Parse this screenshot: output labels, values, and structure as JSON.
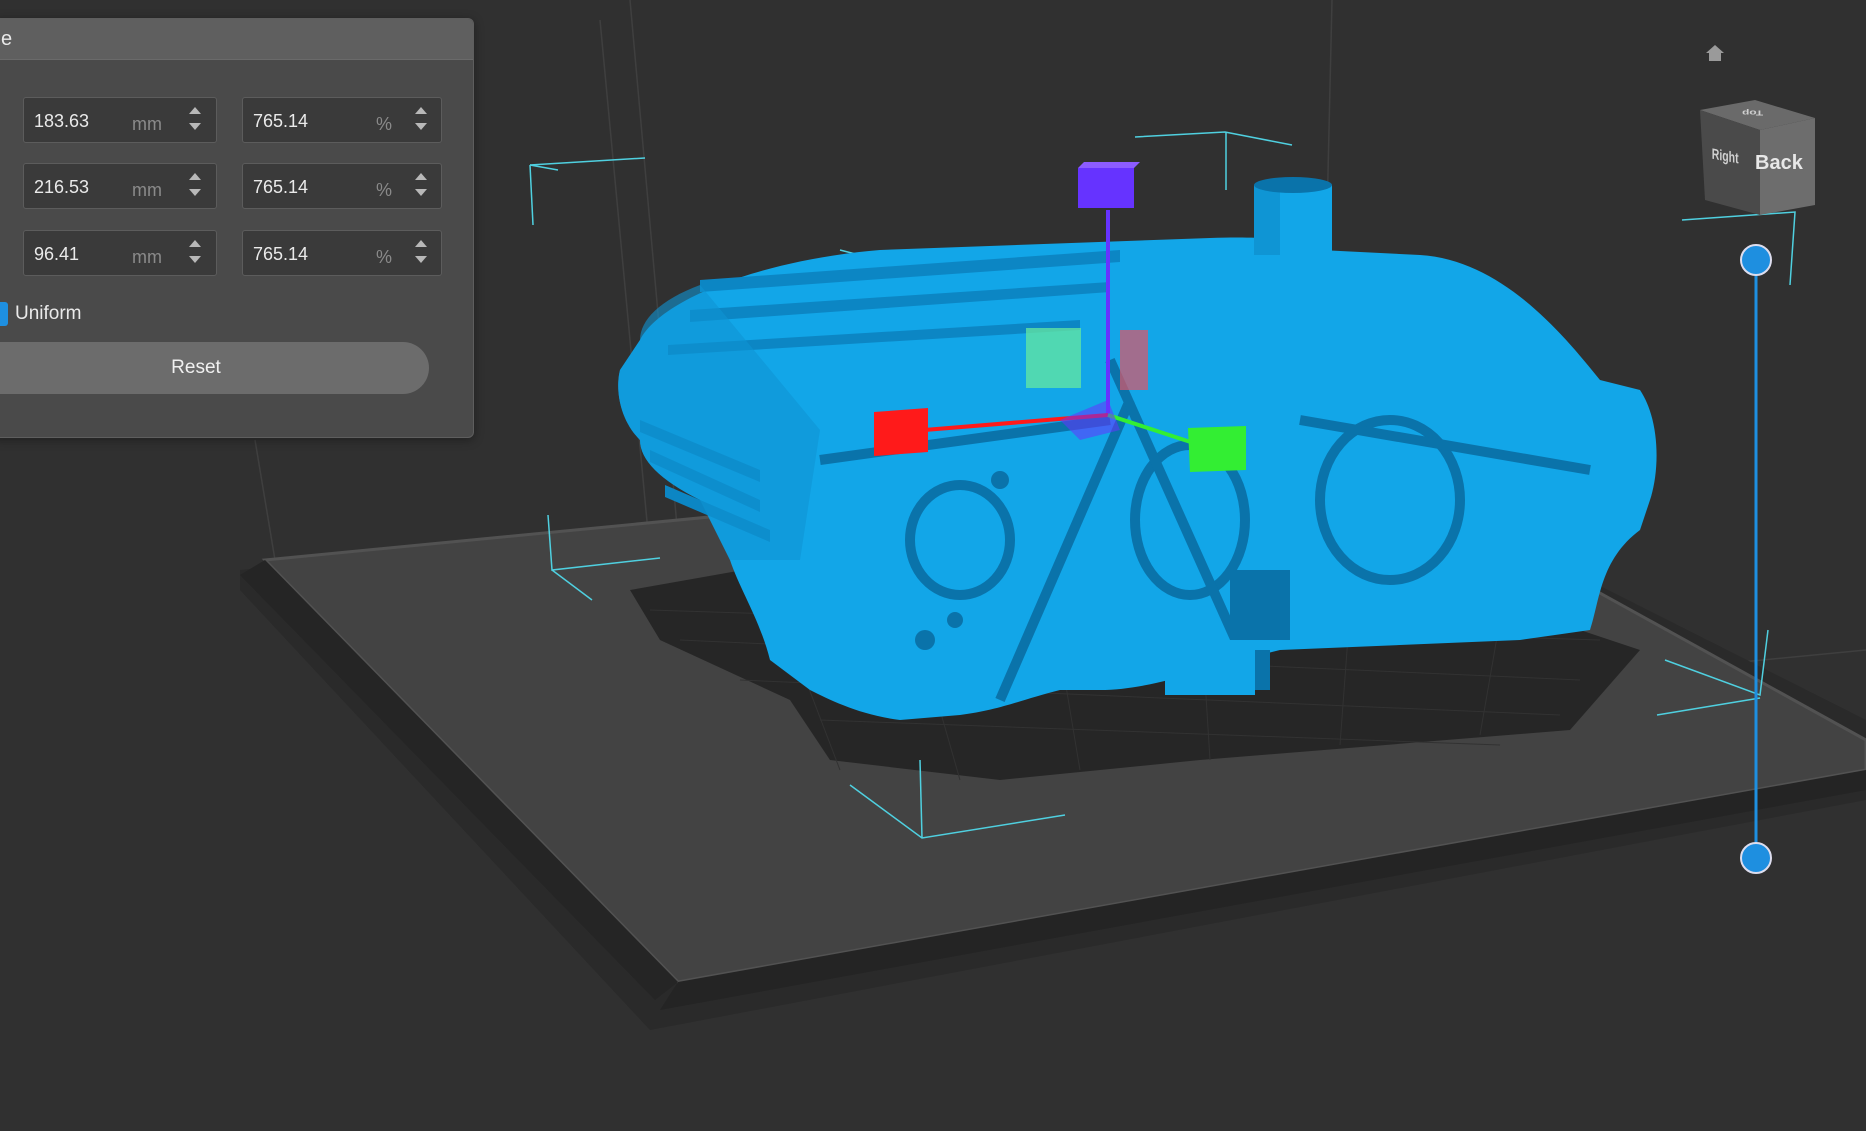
{
  "scale_panel": {
    "title": "e",
    "rows": [
      {
        "size": "183.63",
        "size_unit": "mm",
        "percent": "765.14",
        "percent_unit": "%"
      },
      {
        "size": "216.53",
        "size_unit": "mm",
        "percent": "765.14",
        "percent_unit": "%"
      },
      {
        "size": "96.41",
        "size_unit": "mm",
        "percent": "765.14",
        "percent_unit": "%"
      }
    ],
    "uniform_label": "Uniform",
    "uniform_checked": true,
    "reset_label": "Reset"
  },
  "view_cube": {
    "back_label": "Back",
    "right_label": "Right",
    "top_label": "Top"
  },
  "icons": {
    "home": "home-icon",
    "spin_up": "chevron-up-icon",
    "spin_down": "chevron-down-icon"
  },
  "layer_slider": {
    "min_fraction": 0.0,
    "max_fraction": 1.0
  },
  "colors": {
    "background": "#303030",
    "model": "#12a6e8",
    "accent": "#1e8fe0",
    "axis_x": "#ff1a1a",
    "axis_y": "#33ee33",
    "axis_z": "#6633ff",
    "bounding_box": "#4fd0e0"
  }
}
